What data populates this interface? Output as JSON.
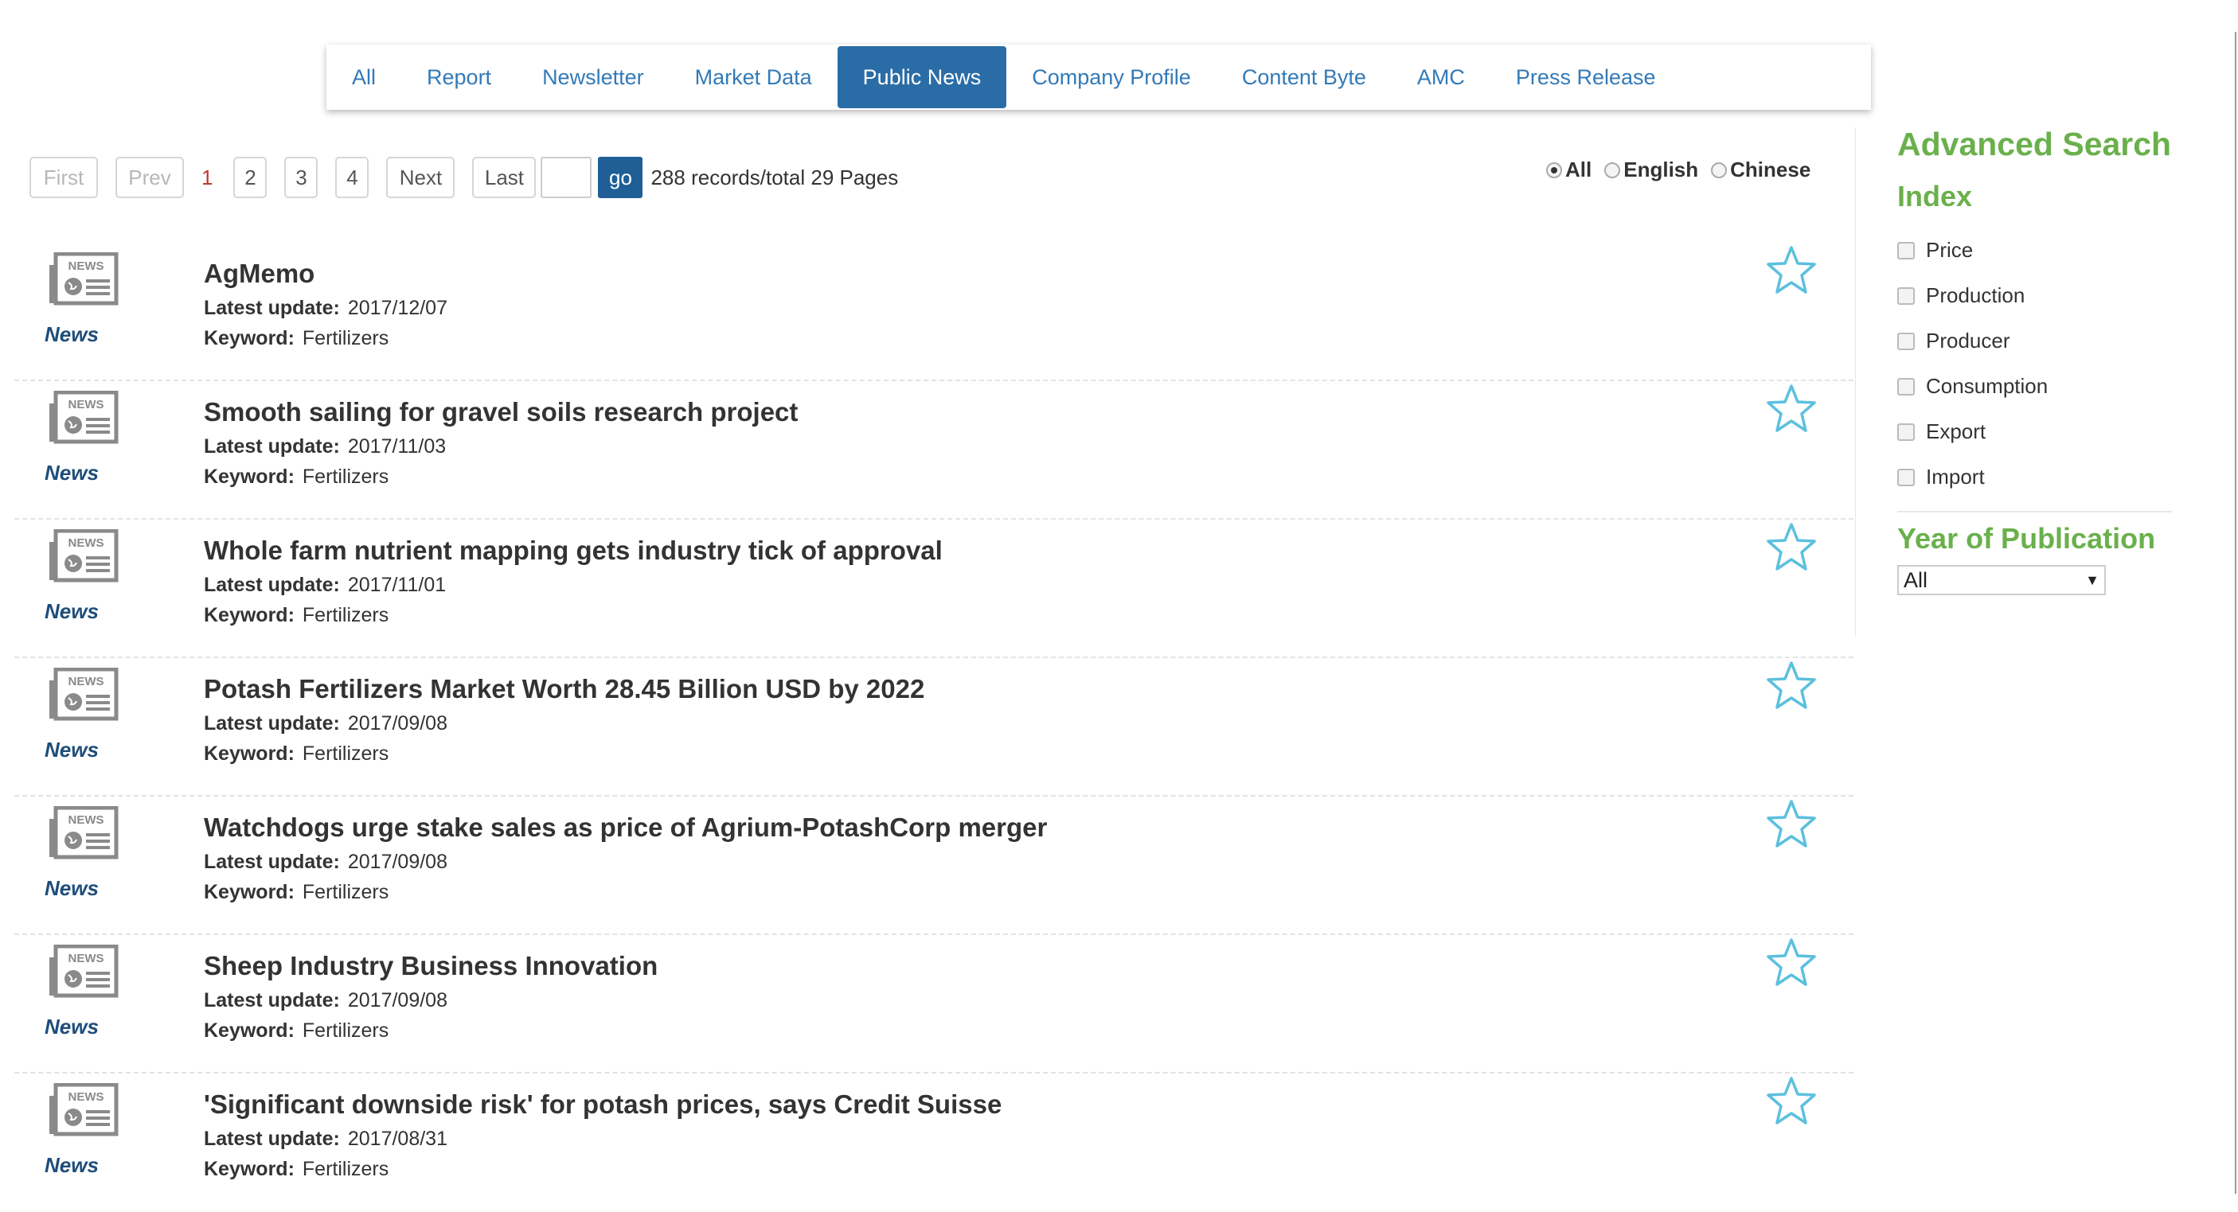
{
  "tabs": [
    {
      "label": "All",
      "active": false
    },
    {
      "label": "Report",
      "active": false
    },
    {
      "label": "Newsletter",
      "active": false
    },
    {
      "label": "Market Data",
      "active": false
    },
    {
      "label": "Public News",
      "active": true
    },
    {
      "label": "Company Profile",
      "active": false
    },
    {
      "label": "Content Byte",
      "active": false
    },
    {
      "label": "AMC",
      "active": false
    },
    {
      "label": "Press Release",
      "active": false
    }
  ],
  "pager": {
    "first": "First",
    "prev": "Prev",
    "current": "1",
    "pages": [
      "2",
      "3",
      "4"
    ],
    "next": "Next",
    "last": "Last",
    "go": "go",
    "summary": "288 records/total 29 Pages"
  },
  "language": {
    "selected": "All",
    "options": [
      "All",
      "English",
      "Chinese"
    ]
  },
  "items": [
    {
      "type_label": "News",
      "title": "AgMemo",
      "update_label": "Latest update:",
      "date": "2017/12/07",
      "keyword_label": "Keyword:",
      "keyword": "Fertilizers"
    },
    {
      "type_label": "News",
      "title": "Smooth sailing for gravel soils research project",
      "update_label": "Latest update:",
      "date": "2017/11/03",
      "keyword_label": "Keyword:",
      "keyword": "Fertilizers"
    },
    {
      "type_label": "News",
      "title": "Whole farm nutrient mapping gets industry tick of approval",
      "update_label": "Latest update:",
      "date": "2017/11/01",
      "keyword_label": "Keyword:",
      "keyword": "Fertilizers"
    },
    {
      "type_label": "News",
      "title": "Potash Fertilizers Market Worth 28.45 Billion USD by 2022",
      "update_label": "Latest update:",
      "date": "2017/09/08",
      "keyword_label": "Keyword:",
      "keyword": "Fertilizers"
    },
    {
      "type_label": "News",
      "title": "Watchdogs urge stake sales as price of Agrium-PotashCorp merger",
      "update_label": "Latest update:",
      "date": "2017/09/08",
      "keyword_label": "Keyword:",
      "keyword": "Fertilizers"
    },
    {
      "type_label": "News",
      "title": "Sheep Industry Business Innovation",
      "update_label": "Latest update:",
      "date": "2017/09/08",
      "keyword_label": "Keyword:",
      "keyword": "Fertilizers"
    },
    {
      "type_label": "News",
      "title": "'Significant downside risk' for potash prices, says Credit Suisse",
      "update_label": "Latest update:",
      "date": "2017/08/31",
      "keyword_label": "Keyword:",
      "keyword": "Fertilizers"
    }
  ],
  "sidebar": {
    "title": "Advanced Search",
    "index_heading": "Index",
    "index_options": [
      "Price",
      "Production",
      "Producer",
      "Consumption",
      "Export",
      "Import"
    ],
    "year_heading": "Year of Publication",
    "year_value": "All",
    "year_arrow": "▼"
  },
  "icons": {
    "news": "news-icon",
    "star": "star-icon"
  },
  "colors": {
    "accent": "#2a6ca6",
    "sidebar_heading": "#6ab04c",
    "star": "#5bc0de"
  }
}
